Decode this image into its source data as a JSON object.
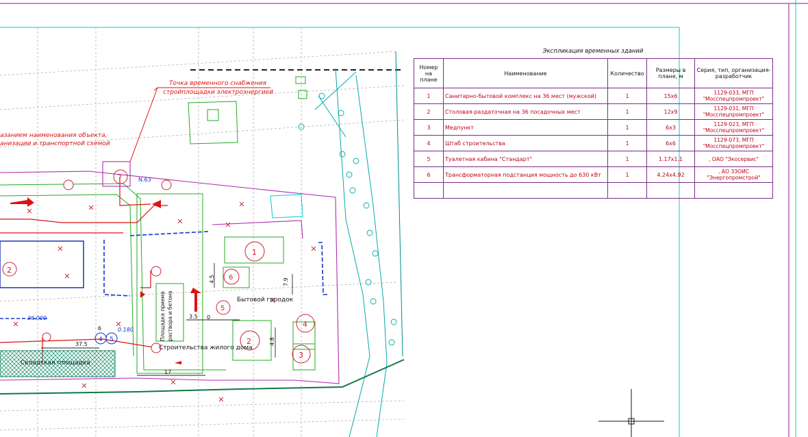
{
  "plan": {
    "labels": {
      "power_point_line1": "Точка временного снабжения",
      "power_point_line2": "стройплощадки электроэнергией",
      "left_note_line1": "азанием наименования объекта,",
      "left_note_line2": "анизации и транспортной схемой",
      "household_yard": "Бытовой городок",
      "building_under_construction": "Строительства жилого дома",
      "storage_area": "Складская площадка",
      "mortar_area_line1": "Площадка приема",
      "mortar_area_line2": "раствора и бетона",
      "dim_17": "17",
      "dim_37_5": "37.5",
      "dim_3_5": "3.5",
      "dim_4_5": "4.5",
      "dim_7_9": "7.9",
      "dim_4_8": "4.8",
      "dim_6": "6",
      "dim_0": "0",
      "elev_36": "36.000",
      "elev_0180": "0.180",
      "node_n63": "N.63",
      "mark_1": "1",
      "mark_2": "2",
      "mark_3": "3",
      "mark_4": "4",
      "mark_5": "5",
      "mark_6": "6",
      "mark_7": "7",
      "mark_4_5": "4",
      "mark_5_5": "5",
      "left_2": "2"
    }
  },
  "explication": {
    "title": "Экспликация временных зданий",
    "headers": {
      "num": "Номер на плане",
      "name": "Наименование",
      "qty": "Количество",
      "size": "Размеры в плане, м",
      "series": "Серия, тип, организация-разработчик"
    },
    "rows": [
      {
        "num": "1",
        "name": "Санитарно-бытовой комплекс на 36 мест (мужской)",
        "qty": "1",
        "size": "15x6",
        "series_1": "1129-033, МГП",
        "series_2": "\"Мосспецпромпроект\""
      },
      {
        "num": "2",
        "name": "Столовая-раздаточная на 36 посадочных мест",
        "qty": "1",
        "size": "12x9",
        "series_1": "1129-031, МГП",
        "series_2": "\"Мосспецпромпроект\""
      },
      {
        "num": "3",
        "name": "Медпункт",
        "qty": "1",
        "size": "6x3",
        "series_1": "1129-023, МГП",
        "series_2": "\"Мосспецпромпроект\""
      },
      {
        "num": "4",
        "name": "Штаб строительства",
        "qty": "1",
        "size": "6x6",
        "series_1": "1129-073, МГП",
        "series_2": "\"Мосспецпромпроект\""
      },
      {
        "num": "5",
        "name": "Туалетная кабина \"Стандарт\"",
        "qty": "1",
        "size": "1.17x1.1",
        "series_1": ", ОАО \"Экосервис\"",
        "series_2": ""
      },
      {
        "num": "6",
        "name": "Трансформаторная подстанция мощность до 630 кВт",
        "qty": "1",
        "size": "4.24x4.92",
        "series_1": ", АО ЗЗОИС",
        "series_2": "\"Энергопромстрой\""
      }
    ]
  },
  "colors": {
    "background": "#ffffff",
    "frame_magenta": "#8a1a9a",
    "frame_cyan": "#00cccc",
    "red": "#dd1111",
    "green": "#22aa22",
    "blue": "#1133cc"
  }
}
